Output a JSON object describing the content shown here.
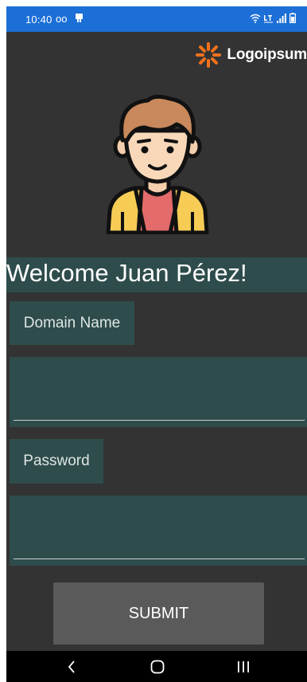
{
  "status_bar": {
    "time": "10:40",
    "voicemail_glyph": "oo",
    "background": "#1c6fd6"
  },
  "logo": {
    "text": "Logoipsum",
    "accent": "#f2711c"
  },
  "welcome": {
    "text": "Welcome Juan Pérez!"
  },
  "form": {
    "domain_label": "Domain Name",
    "domain_value": "",
    "password_label": "Password",
    "password_value": "",
    "submit_label": "SUBMIT",
    "panel_color": "#2e4c4b"
  },
  "icons": {
    "status": [
      "voicemail-icon",
      "notification-icon",
      "wifi-icon",
      "lte-icon",
      "signal-icon",
      "battery-icon"
    ],
    "nav": [
      "back-icon",
      "home-icon",
      "recents-icon"
    ]
  }
}
